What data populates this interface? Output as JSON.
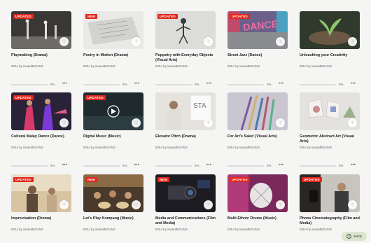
{
  "cards": [
    {
      "badge": "UPDATED",
      "title": "Playmaking (Drama)",
      "author": "IDEA by inwardBOUND",
      "progress": "0%",
      "more": "•••"
    },
    {
      "badge": "NEW",
      "title": "Poetry in Motion (Drama)",
      "author": "IDEA by inwardBOUND",
      "progress": "0%",
      "more": "•••"
    },
    {
      "badge": "UPDATED",
      "title": "Puppetry with Everyday Objects (Visual Arts)",
      "author": "IDEA by inwardBOUND",
      "progress": "0%",
      "more": "•••"
    },
    {
      "badge": "UPDATED",
      "title": "Street Jazz (Dance)",
      "author": "IDEA by inwardBOUND",
      "progress": "0%",
      "more": "•••"
    },
    {
      "badge": "",
      "title": "Unleashing your Creativity",
      "author": "IDEA by inwardBOUND",
      "progress": "0%",
      "more": "•••"
    },
    {
      "badge": "UPDATED",
      "title": "Cultural Malay Dance (Dance)",
      "author": "IDEA by inwardBOUND",
      "progress": "0%",
      "more": "•••"
    },
    {
      "badge": "UPDATED",
      "title": "Digital Music (Music)",
      "author": "IDEA by inwardBOUND",
      "progress": "0%",
      "more": "•••"
    },
    {
      "badge": "",
      "title": "Elevator Pitch (Drama)",
      "author": "IDEA by inwardBOUND",
      "progress": "0%",
      "more": "•••"
    },
    {
      "badge": "",
      "title": "For Art's Sake! (Visual Arts)",
      "author": "IDEA by inwardBOUND",
      "progress": "0%",
      "more": "•••"
    },
    {
      "badge": "",
      "title": "Geometric Abstract Art (Visual Arts)",
      "author": "IDEA by inwardBOUND",
      "progress": "0%",
      "more": "•••"
    },
    {
      "badge": "UPDATED",
      "title": "Improvisation (Drama)",
      "author": "IDEA by inwardBOUND",
      "progress": "0%",
      "more": "•••"
    },
    {
      "badge": "NEW",
      "title": "Let's Play Kompang (Music)",
      "author": "IDEA by inwardBOUND",
      "progress": "0%",
      "more": "•••"
    },
    {
      "badge": "NEW",
      "title": "Media and Communications (Film and Media)",
      "author": "IDEA by inwardBOUND",
      "progress": "0%",
      "more": "•••"
    },
    {
      "badge": "UPDATED",
      "title": "Multi-Ethnic Drums (Music)",
      "author": "IDEA by inwardBOUND",
      "progress": "0%",
      "more": "•••"
    },
    {
      "badge": "UPDATED",
      "title": "Phone Cinematography (Film and Media)",
      "author": "IDEA by inwardBOUND",
      "progress": "0%",
      "more": "•••"
    }
  ],
  "help": {
    "label": "Help"
  }
}
